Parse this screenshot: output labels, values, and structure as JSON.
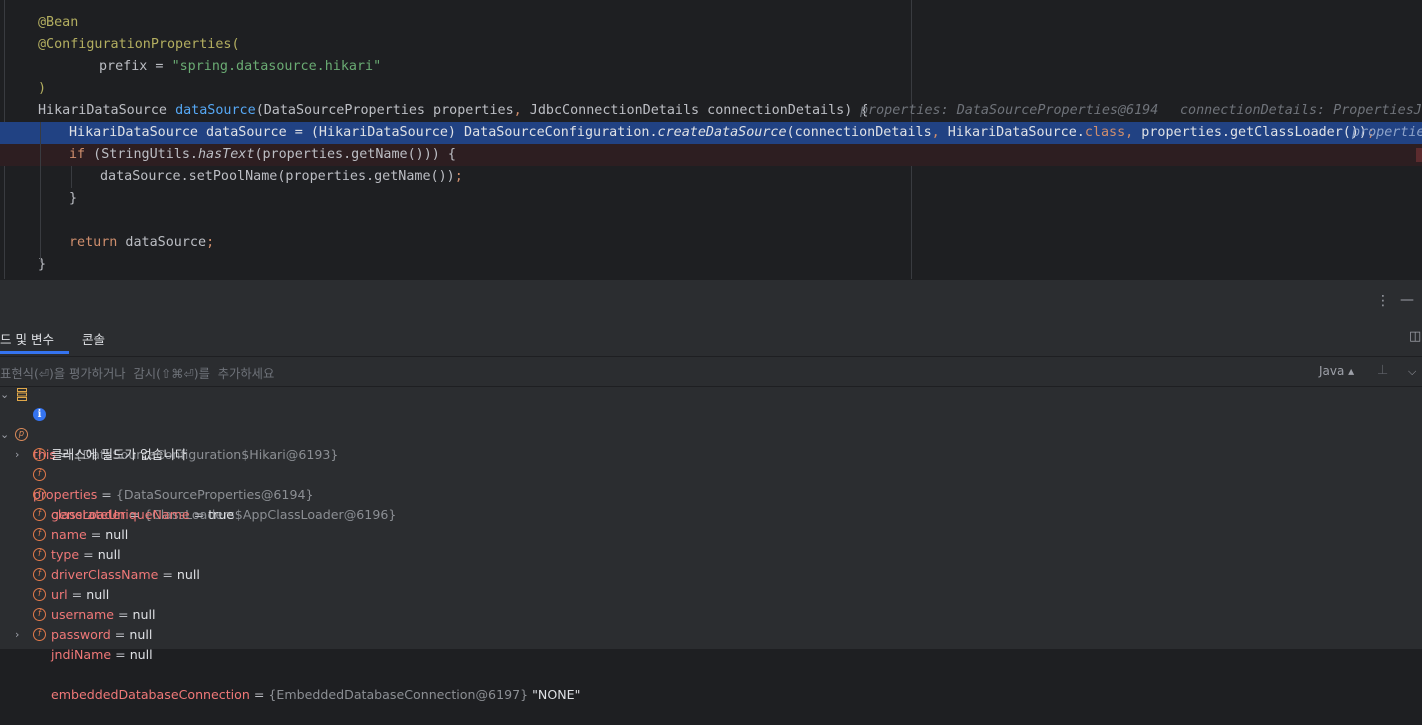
{
  "editor": {
    "lines": {
      "l1": "@Bean",
      "l2": "@ConfigurationProperties(",
      "l3_a": "prefix = ",
      "l3_b": "\"spring.datasource.hikari\"",
      "l4": ")",
      "l5_a": "HikariDataSource ",
      "l5_b": "dataSource",
      "l5_c": "(DataSourceProperties properties",
      "l5_d": ",",
      "l5_e": " JdbcConnectionDetails connectionDetails) {",
      "l5_hint1": "properties: DataSourceProperties@6194",
      "l5_hint2": "connectionDetails: PropertiesJd",
      "l6_a": "HikariDataSource dataSource = (HikariDataSource) DataSourceConfiguration.",
      "l6_b": "createDataSource",
      "l6_c": "(connectionDetails",
      "l6_d": ",",
      "l6_e": " HikariDataSource.",
      "l6_f": "class",
      "l6_g": ",",
      "l6_h": " properties.getClassLoader())",
      "l6_i": ";",
      "l6_hint": "propertie",
      "l7_a": "if",
      "l7_b": " (StringUtils.",
      "l7_c": "hasText",
      "l7_d": "(properties.getName())) {",
      "l8_a": "dataSource.setPoolName(properties.getName())",
      "l8_b": ";",
      "l9": "}",
      "l11_a": "return",
      "l11_b": " dataSource",
      "l11_c": ";",
      "l12": "}"
    }
  },
  "panel": {
    "tabs": [
      "드 및 변수",
      "콘솔"
    ],
    "eval_placeholder": "표현식(⏎)을 평가하거나  감시(⇧⌘⏎)를  추가하세요",
    "language": "Java ▴"
  },
  "variables": {
    "this": {
      "name": "this",
      "type": "{DataSourceConfiguration$Hikari@6193}"
    },
    "no_fields": "클래스에 필드가 없습니다",
    "properties": {
      "name": "properties",
      "type": "{DataSourceProperties@6194}"
    },
    "fields": [
      {
        "name": "classLoader",
        "type": "{ClassLoaders$AppClassLoader@6196}",
        "value": ""
      },
      {
        "name": "generateUniqueName",
        "type": "",
        "value": "true"
      },
      {
        "name": "name",
        "type": "",
        "value": "null"
      },
      {
        "name": "type",
        "type": "",
        "value": "null"
      },
      {
        "name": "driverClassName",
        "type": "",
        "value": "null"
      },
      {
        "name": "url",
        "type": "",
        "value": "null"
      },
      {
        "name": "username",
        "type": "",
        "value": "null"
      },
      {
        "name": "password",
        "type": "",
        "value": "null"
      },
      {
        "name": "jndiName",
        "type": "",
        "value": "null"
      },
      {
        "name": "embeddedDatabaseConnection",
        "type": "{EmbeddedDatabaseConnection@6197}",
        "value": "\"NONE\""
      }
    ]
  },
  "colors": {
    "editor_bg": "#1e1f22",
    "panel_bg": "#2b2d30",
    "highlight_line": "#214283",
    "variable_name": "#f07878",
    "accent": "#3574f0"
  }
}
